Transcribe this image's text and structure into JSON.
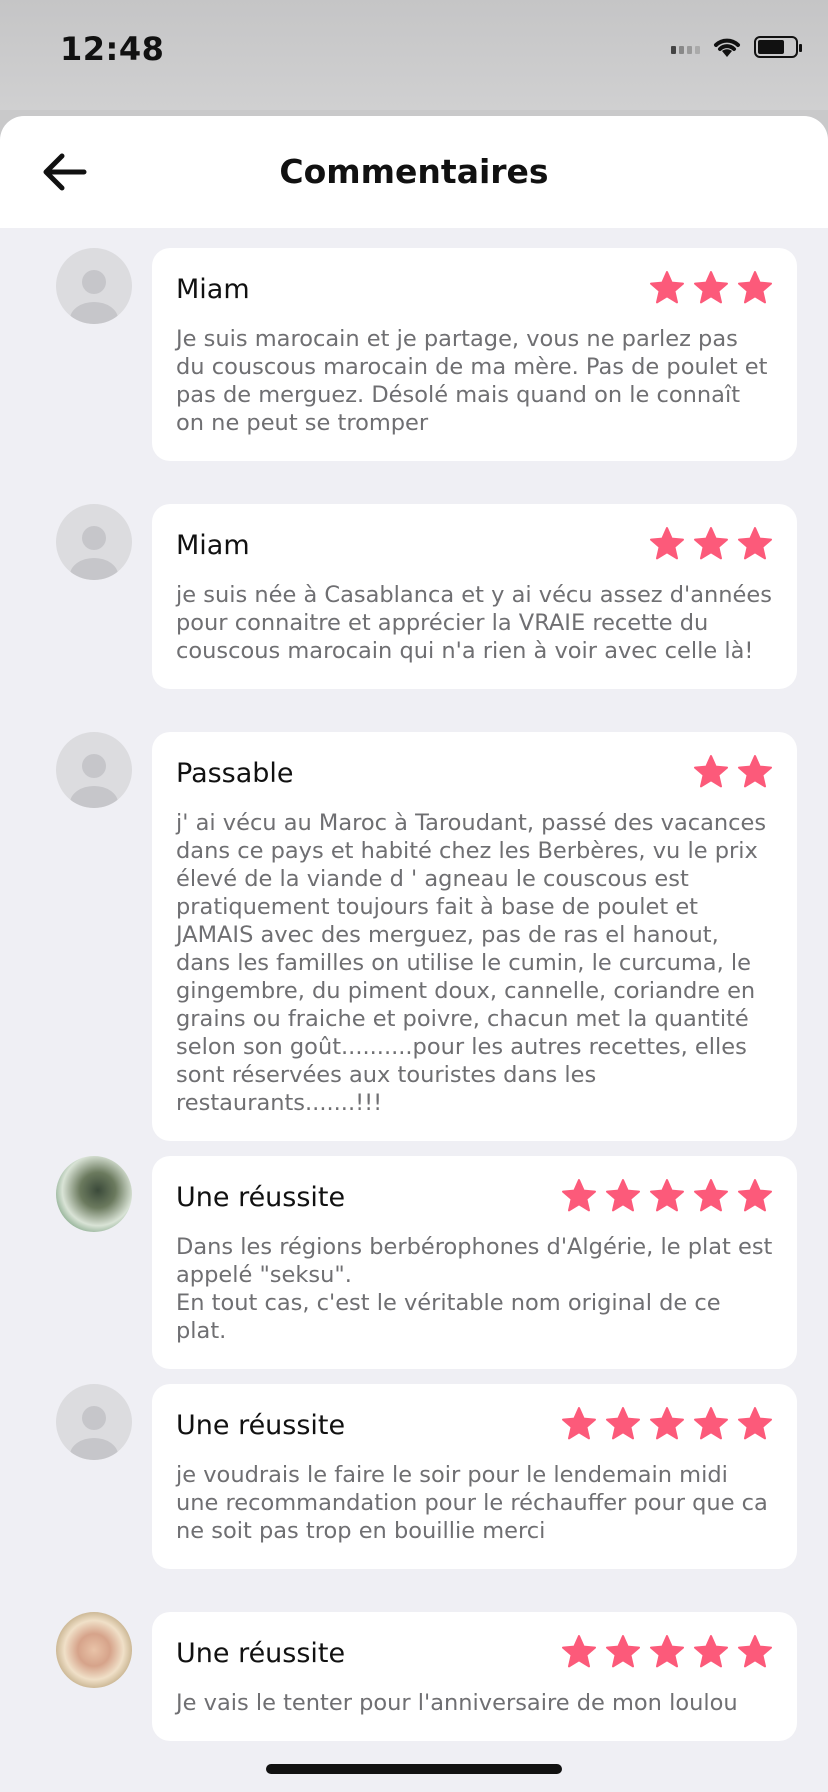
{
  "status_bar": {
    "time": "12:48"
  },
  "header": {
    "title": "Commentaires"
  },
  "colors": {
    "star": "#fc5a7a",
    "background": "#efeff4"
  },
  "reviews": [
    {
      "title": "Miam",
      "rating": 3,
      "avatar": "placeholder",
      "text": "Je suis marocain et je partage, vous ne parlez pas du couscous marocain de ma mère. Pas de poulet et pas de merguez. Désolé mais quand on le connaît on ne peut se tromper"
    },
    {
      "title": "Miam",
      "rating": 3,
      "avatar": "placeholder",
      "text": "je suis née à Casablanca et y ai vécu assez d'années pour connaitre et apprécier la VRAIE recette du couscous marocain qui n'a rien à voir avec celle là!"
    },
    {
      "title": "Passable",
      "rating": 2,
      "avatar": "placeholder",
      "text": "j' ai vécu au Maroc à Taroudant, passé des vacances dans ce pays et habité chez les Berbères, vu le prix élevé de la viande d ' agneau le couscous est pratiquement toujours fait à base de poulet et JAMAIS avec des merguez, pas de ras el hanout, dans les familles on utilise le cumin, le curcuma, le gingembre, du piment doux, cannelle, coriandre en grains ou fraiche et poivre, chacun met la quantité selon son goût..........pour les autres recettes, elles sont réservées aux touristes dans les restaurants.......!!!"
    },
    {
      "title": "Une réussite",
      "rating": 5,
      "avatar": "photo1",
      "text": "Dans les régions berbérophones d'Algérie, le plat est appelé \"seksu\".\nEn tout cas, c'est le véritable nom original de ce plat."
    },
    {
      "title": "Une réussite",
      "rating": 5,
      "avatar": "placeholder",
      "text": "je voudrais le faire le soir pour le lendemain midi une recommandation pour le réchauffer pour que ca  ne soit pas trop en bouillie merci"
    },
    {
      "title": "Une réussite",
      "rating": 5,
      "avatar": "photo2",
      "text": "Je vais le tenter pour l'anniversaire de mon loulou"
    }
  ]
}
